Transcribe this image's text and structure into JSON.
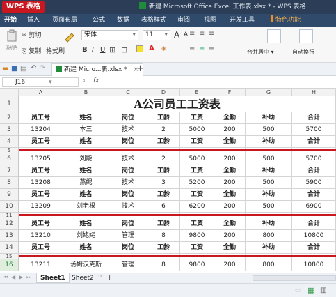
{
  "app": {
    "logo": "WPS 表格",
    "doc_title": "新建 Microsoft Office Excel 工作表.xlsx * - WPS 表格"
  },
  "menu": [
    "开始",
    "插入",
    "页面布局",
    "公式",
    "数据",
    "表格样式",
    "审阅",
    "视图",
    "开发工具",
    "特色功能"
  ],
  "ribbon": {
    "cut": "剪切",
    "paste": "粘贴",
    "copy": "复制",
    "format_painter": "格式刷",
    "font_name": "宋体",
    "font_size": "11",
    "bold": "B",
    "italic": "I",
    "underline": "U",
    "grow": "A",
    "shrink": "A",
    "merge": "合并居中",
    "wrap": "自动换行"
  },
  "file_tab": {
    "label": "新建 Micro...表.xlsx *",
    "close": "×",
    "add": "+"
  },
  "formula": {
    "namebox": "J16",
    "fx": "fx"
  },
  "columns": [
    "A",
    "B",
    "C",
    "D",
    "E",
    "F",
    "G",
    "H"
  ],
  "title_row": {
    "num": "1",
    "text": "A公司员工工资表"
  },
  "rows": [
    {
      "num": "2",
      "hdr": true,
      "cells": [
        "员工号",
        "姓名",
        "岗位",
        "工龄",
        "工资",
        "全勤",
        "补助",
        "合计"
      ]
    },
    {
      "num": "3",
      "hdr": false,
      "cells": [
        "13204",
        "本三",
        "技术",
        "2",
        "5000",
        "200",
        "500",
        "5700"
      ]
    },
    {
      "num": "4",
      "hdr": true,
      "cells": [
        "员工号",
        "姓名",
        "岗位",
        "工龄",
        "工资",
        "全勤",
        "补助",
        "合计"
      ]
    },
    {
      "num": "5",
      "hdr": false,
      "sep": true,
      "cells": [
        "",
        "",
        "",
        "",
        "",
        "",
        "",
        ""
      ]
    },
    {
      "num": "6",
      "hdr": false,
      "cells": [
        "13205",
        "刘能",
        "技术",
        "2",
        "5000",
        "200",
        "500",
        "5700"
      ]
    },
    {
      "num": "7",
      "hdr": true,
      "cells": [
        "员工号",
        "姓名",
        "岗位",
        "工龄",
        "工资",
        "全勤",
        "补助",
        "合计"
      ]
    },
    {
      "num": "8",
      "hdr": false,
      "cells": [
        "13208",
        "燕妮",
        "技术",
        "3",
        "5200",
        "200",
        "500",
        "5900"
      ]
    },
    {
      "num": "9",
      "hdr": true,
      "cells": [
        "员工号",
        "姓名",
        "岗位",
        "工龄",
        "工资",
        "全勤",
        "补助",
        "合计"
      ]
    },
    {
      "num": "10",
      "hdr": false,
      "cells": [
        "13209",
        "刘老根",
        "技术",
        "6",
        "6200",
        "200",
        "500",
        "6900"
      ]
    },
    {
      "num": "11",
      "hdr": false,
      "sep": true,
      "cells": [
        "",
        "",
        "",
        "",
        "",
        "",
        "",
        ""
      ]
    },
    {
      "num": "12",
      "hdr": true,
      "cells": [
        "员工号",
        "姓名",
        "岗位",
        "工龄",
        "工资",
        "全勤",
        "补助",
        "合计"
      ]
    },
    {
      "num": "13",
      "hdr": false,
      "cells": [
        "13210",
        "刘姥姥",
        "管理",
        "8",
        "9800",
        "200",
        "800",
        "10800"
      ]
    },
    {
      "num": "14",
      "hdr": true,
      "cells": [
        "员工号",
        "姓名",
        "岗位",
        "工龄",
        "工资",
        "全勤",
        "补助",
        "合计"
      ]
    },
    {
      "num": "15",
      "hdr": false,
      "sep": true,
      "cells": [
        "",
        "",
        "",
        "",
        "",
        "",
        "",
        ""
      ]
    },
    {
      "num": "16",
      "hdr": false,
      "active": true,
      "cells": [
        "13211",
        "汤姆汉克斯",
        "管理",
        "8",
        "9800",
        "200",
        "800",
        "10800"
      ]
    }
  ],
  "sheets": [
    "Sheet1",
    "Sheet2"
  ],
  "sheet_more": "···",
  "sheet_add": "+",
  "colors": {
    "titlebar": "#2c3e57",
    "menubar": "#2f4a6b",
    "logo": "#c9171f",
    "separator": "#c8171f",
    "active_row": "#1a7a2e"
  }
}
